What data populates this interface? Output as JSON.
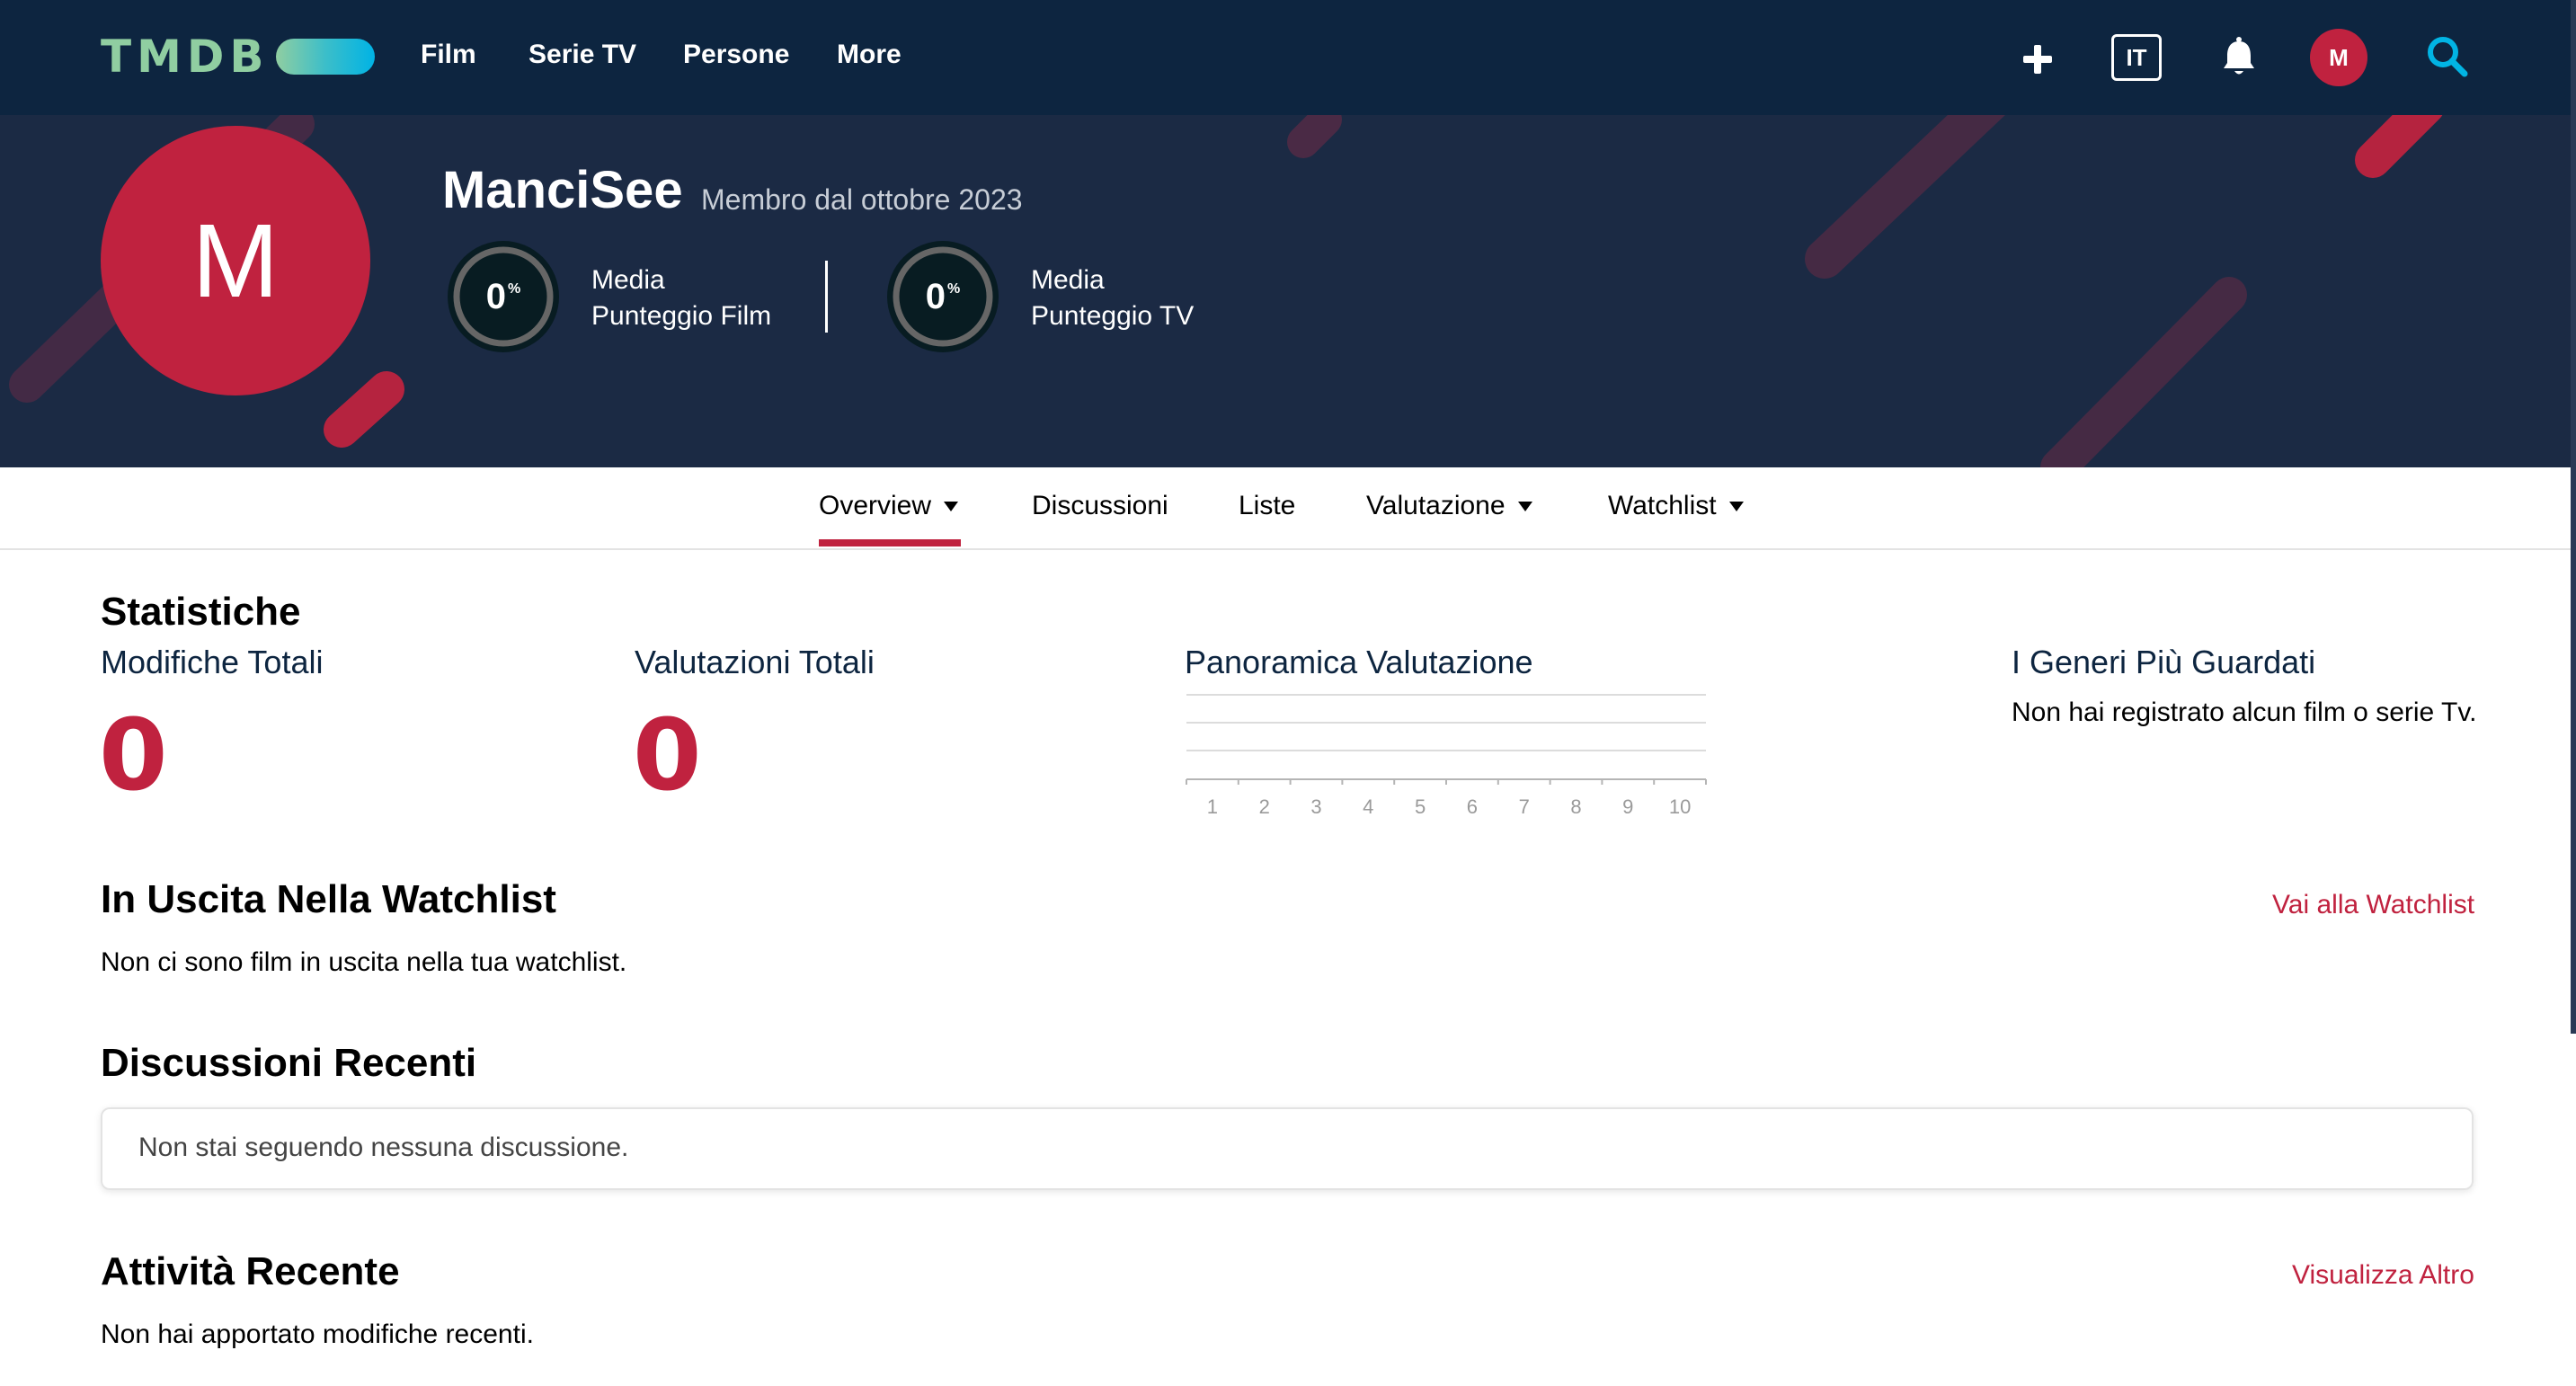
{
  "app": {
    "logo": "TMDB",
    "accent_color": "#c0223f",
    "nav_bg": "#0d2540",
    "logo_gradient": [
      "#90cea1",
      "#3cbec9",
      "#00b3e5"
    ]
  },
  "nav": {
    "links": [
      "Film",
      "Serie TV",
      "Persone",
      "More"
    ],
    "language": "IT",
    "avatar_initial": "M",
    "icons": [
      "plus-icon",
      "bell-icon",
      "search-icon"
    ]
  },
  "profile": {
    "initial": "M",
    "username": "ManciSee",
    "member_since": "Membro dal ottobre 2023",
    "scores": [
      {
        "value": "0",
        "unit": "%",
        "line1": "Media",
        "line2": "Punteggio Film"
      },
      {
        "value": "0",
        "unit": "%",
        "line1": "Media",
        "line2": "Punteggio TV"
      }
    ]
  },
  "tabs": [
    {
      "label": "Overview",
      "dropdown": true,
      "active": true
    },
    {
      "label": "Discussioni",
      "dropdown": false,
      "active": false
    },
    {
      "label": "Liste",
      "dropdown": false,
      "active": false
    },
    {
      "label": "Valutazione",
      "dropdown": true,
      "active": false
    },
    {
      "label": "Watchlist",
      "dropdown": true,
      "active": false
    }
  ],
  "stats": {
    "title": "Statistiche",
    "total_edits_label": "Modifiche Totali",
    "total_edits_value": "0",
    "total_ratings_label": "Valutazioni Totali",
    "total_ratings_value": "0",
    "overview_label": "Panoramica Valutazione",
    "genres_label": "I Generi Più Guardati",
    "genres_empty": "Non hai registrato alcun film o serie Tv."
  },
  "chart_data": {
    "type": "bar",
    "categories": [
      "1",
      "2",
      "3",
      "4",
      "5",
      "6",
      "7",
      "8",
      "9",
      "10"
    ],
    "values": [
      0,
      0,
      0,
      0,
      0,
      0,
      0,
      0,
      0,
      0
    ],
    "title": "Panoramica Valutazione",
    "xlabel": "",
    "ylabel": "",
    "grid": true
  },
  "watchlist": {
    "title": "In Uscita Nella Watchlist",
    "link": "Vai alla Watchlist",
    "empty": "Non ci sono film in uscita nella tua watchlist."
  },
  "discussions": {
    "title": "Discussioni Recenti",
    "empty": "Non stai seguendo nessuna discussione."
  },
  "activity": {
    "title": "Attività Recente",
    "link": "Visualizza Altro",
    "empty": "Non hai apportato modifiche recenti."
  }
}
